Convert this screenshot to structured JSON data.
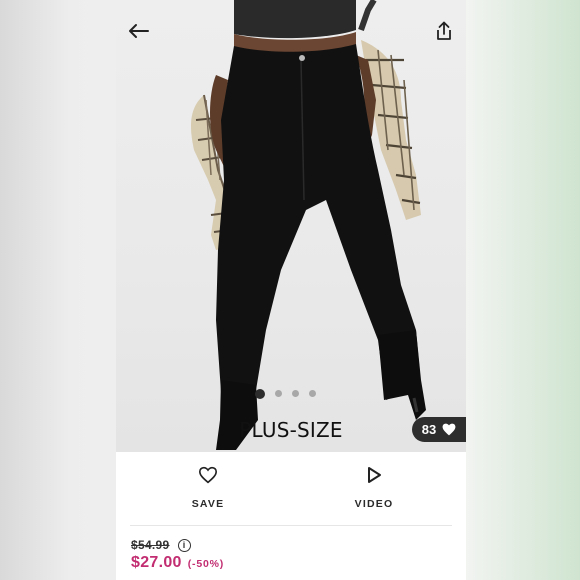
{
  "product": {
    "caption": "PLUS-SIZE",
    "likes_count": "83",
    "carousel": {
      "total": 4,
      "active": 1
    }
  },
  "actions": {
    "save_label": "SAVE",
    "video_label": "VIDEO"
  },
  "pricing": {
    "original_price": "$54.99",
    "sale_price": "$27.00",
    "discount": "(-50%)",
    "info_glyph": "i"
  },
  "colors": {
    "sale": "#c22d71",
    "likes_badge": "#2e2e2e",
    "background": "#ffffff"
  },
  "icons": {
    "back": "arrow-left-icon",
    "share": "share-icon",
    "like": "heart-icon",
    "save": "heart-outline-icon",
    "video": "play-icon",
    "info": "info-icon"
  }
}
